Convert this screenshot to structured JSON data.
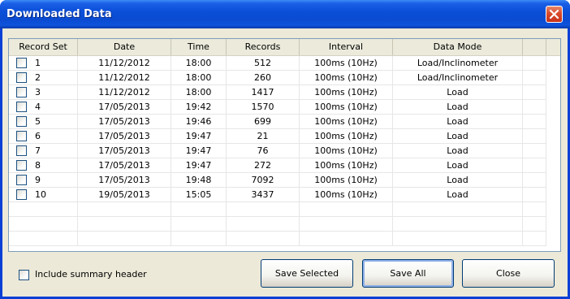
{
  "window": {
    "title": "Downloaded Data"
  },
  "columns": [
    "Record Set",
    "Date",
    "Time",
    "Records",
    "Interval",
    "Data Mode"
  ],
  "rows": [
    [
      "1",
      "11/12/2012",
      "18:00",
      "512",
      "100ms (10Hz)",
      "Load/Inclinometer"
    ],
    [
      "2",
      "11/12/2012",
      "18:00",
      "260",
      "100ms (10Hz)",
      "Load/Inclinometer"
    ],
    [
      "3",
      "11/12/2012",
      "18:00",
      "1417",
      "100ms (10Hz)",
      "Load"
    ],
    [
      "4",
      "17/05/2013",
      "19:42",
      "1570",
      "100ms (10Hz)",
      "Load"
    ],
    [
      "5",
      "17/05/2013",
      "19:46",
      "699",
      "100ms (10Hz)",
      "Load"
    ],
    [
      "6",
      "17/05/2013",
      "19:47",
      "21",
      "100ms (10Hz)",
      "Load"
    ],
    [
      "7",
      "17/05/2013",
      "19:47",
      "76",
      "100ms (10Hz)",
      "Load"
    ],
    [
      "8",
      "17/05/2013",
      "19:47",
      "272",
      "100ms (10Hz)",
      "Load"
    ],
    [
      "9",
      "17/05/2013",
      "19:48",
      "7092",
      "100ms (10Hz)",
      "Load"
    ],
    [
      "10",
      "19/05/2013",
      "15:05",
      "3437",
      "100ms (10Hz)",
      "Load"
    ]
  ],
  "options": {
    "include_summary_label": "Include summary header",
    "include_summary_checked": false
  },
  "buttons": {
    "save_selected": "Save Selected",
    "save_all": "Save All",
    "close": "Close"
  },
  "icons": {
    "close": "close-icon",
    "checkbox": "checkbox-icon"
  },
  "colors": {
    "titlebar": "#0a4bd2",
    "close_button": "#d94a2a",
    "dialog_bg": "#ece9d8",
    "grid_border": "#7f9db9"
  }
}
